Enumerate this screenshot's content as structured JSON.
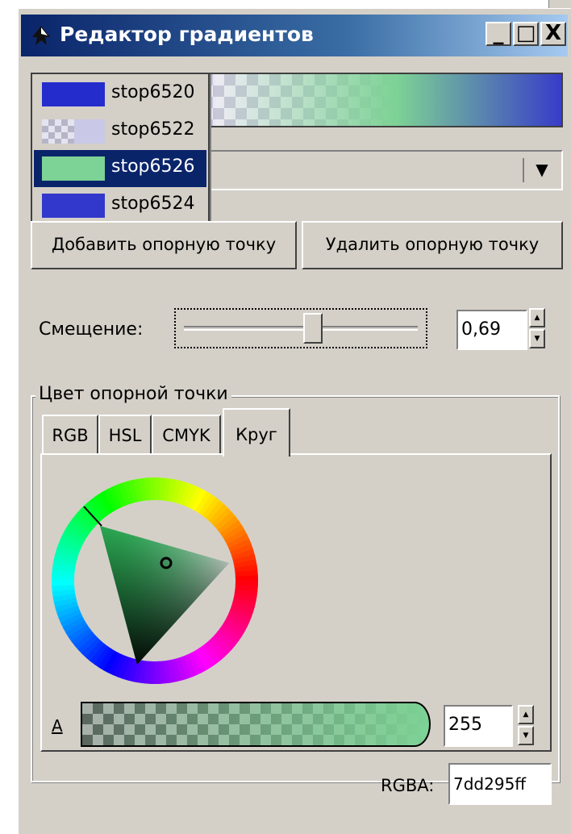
{
  "window": {
    "title": "Редактор градиентов",
    "controls": {
      "minimize": "_",
      "maximize": "□",
      "close": "X"
    }
  },
  "stops": [
    {
      "label": "stop6520",
      "color": "#252ccc",
      "pattern": "solid"
    },
    {
      "label": "stop6522",
      "color": "#c9c8e6",
      "pattern": "checker"
    },
    {
      "label": "stop6526",
      "color": "#7dd295",
      "pattern": "solid",
      "selected": true
    },
    {
      "label": "stop6524",
      "color": "#3238cc",
      "pattern": "solid"
    }
  ],
  "buttons": {
    "add_stop": "Добавить опорную точку",
    "delete_stop": "Удалить опорную точку"
  },
  "offset": {
    "label": "Смещение:",
    "value": "0,69",
    "fraction": 0.69
  },
  "stop_color": {
    "legend": "Цвет опорной точки",
    "tabs": [
      "RGB",
      "HSL",
      "CMYK",
      "Круг"
    ],
    "active_tab": "Круг",
    "alpha_label": "A",
    "alpha_value": "255",
    "rgba_label": "RGBA:",
    "rgba_value": "7dd295ff"
  },
  "icons": {
    "title": "inkscape-icon",
    "combo_arrow": "triangle-down-icon",
    "spin_up": "triangle-up-icon",
    "spin_down": "triangle-down-icon"
  },
  "colors": {
    "selection": "#0a246a",
    "face": "#d4d0c8",
    "current_stop": "#7dd295"
  }
}
